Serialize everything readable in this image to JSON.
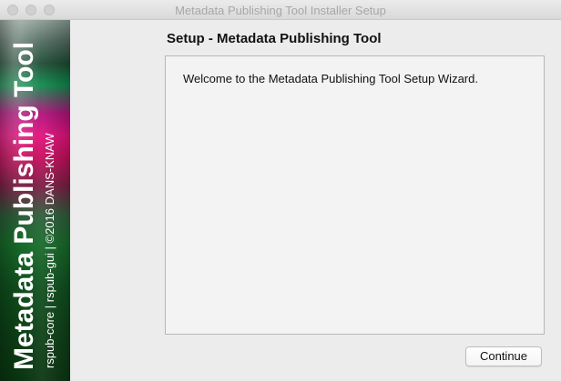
{
  "window": {
    "title": "Metadata Publishing Tool Installer Setup"
  },
  "banner": {
    "title": "Metadata Publishing Tool",
    "subtitle": "rspub-core | rspub-gui | ©2016 DANS-KNAW"
  },
  "main": {
    "heading": "Setup - Metadata Publishing Tool",
    "welcome_text": "Welcome to the Metadata Publishing Tool Setup Wizard."
  },
  "buttons": {
    "continue_label": "Continue"
  },
  "colors": {
    "window_bg": "#ececec",
    "content_bg": "#f3f3f3",
    "banner_magenta": "#e2117d",
    "banner_green": "#176b2a"
  }
}
